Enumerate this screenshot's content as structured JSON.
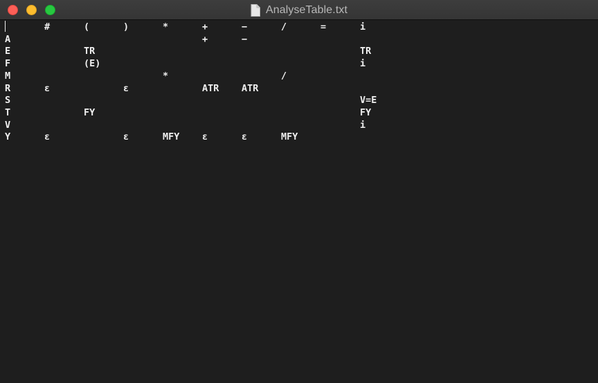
{
  "window": {
    "title": "AnalyseTable.txt",
    "icons": {
      "close": "close-button",
      "minimize": "minimize-button",
      "maximize": "zoom-button",
      "document": "document-icon"
    },
    "colors": {
      "background": "#1e1e1e",
      "text": "#f0f0f0",
      "close": "#fd5f57",
      "minimize": "#fdbd2e",
      "maximize": "#27c840"
    }
  },
  "table": {
    "header": [
      "#",
      "(",
      ")",
      "*",
      "+",
      "−",
      "/",
      "=",
      "i"
    ],
    "rows": [
      {
        "label": "A",
        "cells": [
          "",
          "",
          "",
          "",
          "+",
          "−",
          "",
          "",
          ""
        ]
      },
      {
        "label": "E",
        "cells": [
          "",
          "TR",
          "",
          "",
          "",
          "",
          "",
          "",
          "TR"
        ]
      },
      {
        "label": "F",
        "cells": [
          "",
          "(E)",
          "",
          "",
          "",
          "",
          "",
          "",
          "i"
        ]
      },
      {
        "label": "M",
        "cells": [
          "",
          "",
          "",
          "*",
          "",
          "",
          "/",
          "",
          ""
        ]
      },
      {
        "label": "R",
        "cells": [
          "ε",
          "",
          "ε",
          "",
          "ATR",
          "ATR",
          "",
          "",
          ""
        ]
      },
      {
        "label": "S",
        "cells": [
          "",
          "",
          "",
          "",
          "",
          "",
          "",
          "",
          "V=E"
        ]
      },
      {
        "label": "T",
        "cells": [
          "",
          "FY",
          "",
          "",
          "",
          "",
          "",
          "",
          "FY"
        ]
      },
      {
        "label": "V",
        "cells": [
          "",
          "",
          "",
          "",
          "",
          "",
          "",
          "",
          "i"
        ]
      },
      {
        "label": "Y",
        "cells": [
          "ε",
          "",
          "ε",
          "MFY",
          "ε",
          "ε",
          "MFY",
          "",
          ""
        ]
      }
    ]
  }
}
